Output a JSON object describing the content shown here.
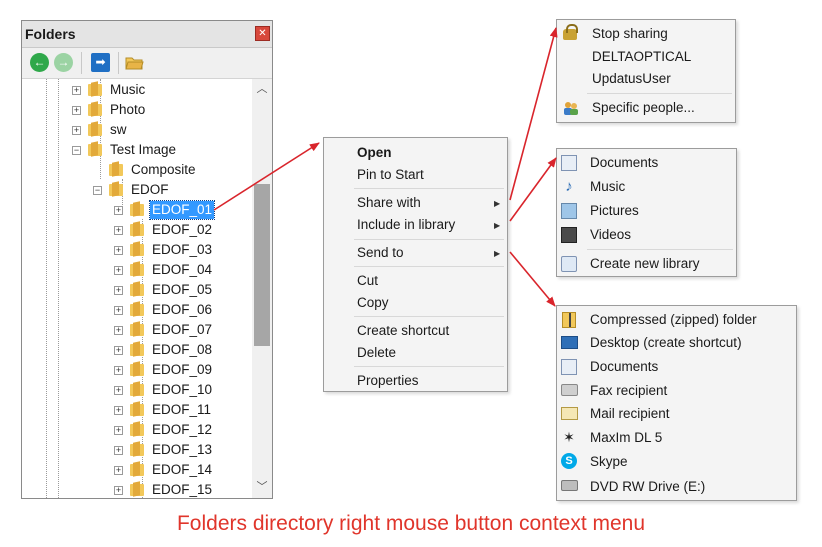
{
  "folders_panel": {
    "title": "Folders",
    "close_icon": "close-icon",
    "toolbar": {
      "back_icon": "back-arrow-icon",
      "forward_icon": "forward-arrow-icon",
      "up_icon": "up-level-icon",
      "folder_icon": "open-folder-icon"
    },
    "tree": [
      {
        "label": "Music",
        "expander": "+"
      },
      {
        "label": "Photo",
        "expander": "+"
      },
      {
        "label": "sw",
        "expander": "+"
      },
      {
        "label": "Test Image",
        "expander": "−"
      },
      {
        "label": "Composite",
        "expander": ""
      },
      {
        "label": "EDOF",
        "expander": "−"
      },
      {
        "label": "EDOF_01",
        "expander": "+",
        "selected": true
      },
      {
        "label": "EDOF_02",
        "expander": "+"
      },
      {
        "label": "EDOF_03",
        "expander": "+"
      },
      {
        "label": "EDOF_04",
        "expander": "+"
      },
      {
        "label": "EDOF_05",
        "expander": "+"
      },
      {
        "label": "EDOF_06",
        "expander": "+"
      },
      {
        "label": "EDOF_07",
        "expander": "+"
      },
      {
        "label": "EDOF_08",
        "expander": "+"
      },
      {
        "label": "EDOF_09",
        "expander": "+"
      },
      {
        "label": "EDOF_10",
        "expander": "+"
      },
      {
        "label": "EDOF_11",
        "expander": "+"
      },
      {
        "label": "EDOF_12",
        "expander": "+"
      },
      {
        "label": "EDOF_13",
        "expander": "+"
      },
      {
        "label": "EDOF_14",
        "expander": "+"
      },
      {
        "label": "EDOF_15",
        "expander": "+"
      }
    ]
  },
  "context_menu": {
    "open": "Open",
    "pin_to_start": "Pin to Start",
    "share_with": "Share with",
    "include_in_library": "Include in library",
    "send_to": "Send to",
    "cut": "Cut",
    "copy": "Copy",
    "create_shortcut": "Create shortcut",
    "delete": "Delete",
    "properties": "Properties"
  },
  "share_menu": {
    "items": [
      "Stop sharing",
      "DELTAOPTICAL",
      "UpdatusUser",
      "Specific people..."
    ],
    "icons": [
      "lock-icon",
      "",
      "",
      "people-icon"
    ]
  },
  "library_menu": {
    "items": [
      "Documents",
      "Music",
      "Pictures",
      "Videos",
      "Create new library"
    ],
    "icons": [
      "documents-library-icon",
      "music-library-icon",
      "pictures-library-icon",
      "videos-library-icon",
      "new-library-icon"
    ]
  },
  "send_menu": {
    "items": [
      "Compressed (zipped) folder",
      "Desktop (create shortcut)",
      "Documents",
      "Fax recipient",
      "Mail recipient",
      "MaxIm DL 5",
      "Skype",
      "DVD RW Drive (E:)"
    ],
    "icons": [
      "zip-folder-icon",
      "desktop-icon",
      "documents-icon",
      "fax-icon",
      "mail-icon",
      "maxim-dl-icon",
      "skype-icon",
      "dvd-drive-icon"
    ]
  },
  "caption": "Folders directory right mouse button context menu",
  "colors": {
    "arrow": "#d9252c",
    "caption": "#e0352b",
    "selection": "#3399ff"
  }
}
